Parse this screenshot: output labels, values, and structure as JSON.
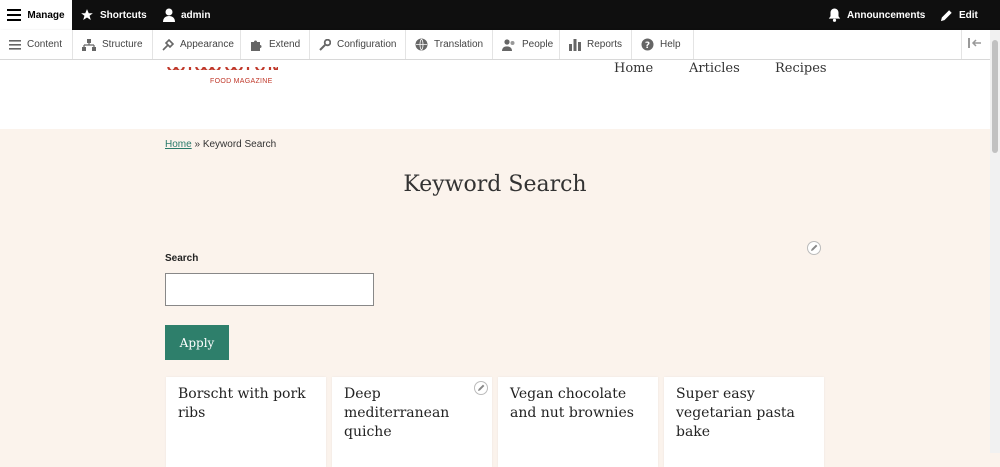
{
  "toolbar": {
    "manage_label": "Manage",
    "shortcuts_label": "Shortcuts",
    "user_label": "admin",
    "announcements_label": "Announcements",
    "edit_label": "Edit"
  },
  "admin_menu": {
    "items": [
      {
        "label": "Content",
        "icon": "content-icon"
      },
      {
        "label": "Structure",
        "icon": "structure-icon"
      },
      {
        "label": "Appearance",
        "icon": "appearance-icon"
      },
      {
        "label": "Extend",
        "icon": "extend-icon"
      },
      {
        "label": "Configuration",
        "icon": "configuration-icon"
      },
      {
        "label": "Translation",
        "icon": "translation-icon"
      },
      {
        "label": "People",
        "icon": "people-icon"
      },
      {
        "label": "Reports",
        "icon": "reports-icon"
      },
      {
        "label": "Help",
        "icon": "help-icon"
      }
    ]
  },
  "site": {
    "logo_subtitle": "FOOD MAGAZINE",
    "nav": [
      "Home",
      "Articles",
      "Recipes"
    ]
  },
  "breadcrumb": {
    "home": "Home",
    "separator": "»",
    "current": "Keyword Search"
  },
  "page": {
    "title": "Keyword Search"
  },
  "search": {
    "label": "Search",
    "value": "",
    "placeholder": "",
    "apply_label": "Apply"
  },
  "cards": [
    {
      "title": "Borscht with pork ribs"
    },
    {
      "title": "Deep mediterranean quiche"
    },
    {
      "title": "Vegan chocolate and nut brownies"
    },
    {
      "title": "Super easy vegetarian pasta bake"
    }
  ],
  "colors": {
    "toolbar_bg": "#0f0f0f",
    "accent": "#2e7f6b",
    "brand": "#c0392b",
    "page_bg": "#fbf3ec"
  }
}
